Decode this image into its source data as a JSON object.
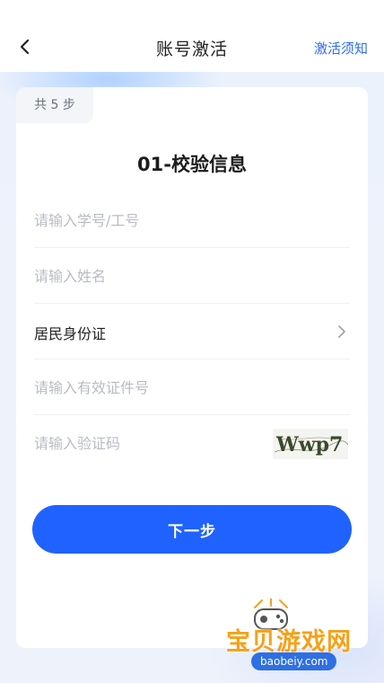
{
  "nav": {
    "title": "账号激活",
    "right_link": "激活须知"
  },
  "card": {
    "steps_badge": "共 5 步",
    "section_title": "01-校验信息"
  },
  "form": {
    "student_id_placeholder": "请输入学号/工号",
    "name_placeholder": "请输入姓名",
    "id_type_value": "居民身份证",
    "id_number_placeholder": "请输入有效证件号",
    "captcha_placeholder": "请输入验证码",
    "captcha_text": "Wwp7"
  },
  "buttons": {
    "next": "下一步"
  },
  "watermark": {
    "text": "宝贝游戏网",
    "url": "baobeiy.com"
  },
  "colors": {
    "accent": "#1f62ff",
    "link": "#2b6cf6",
    "watermark": "#f6a11a"
  }
}
